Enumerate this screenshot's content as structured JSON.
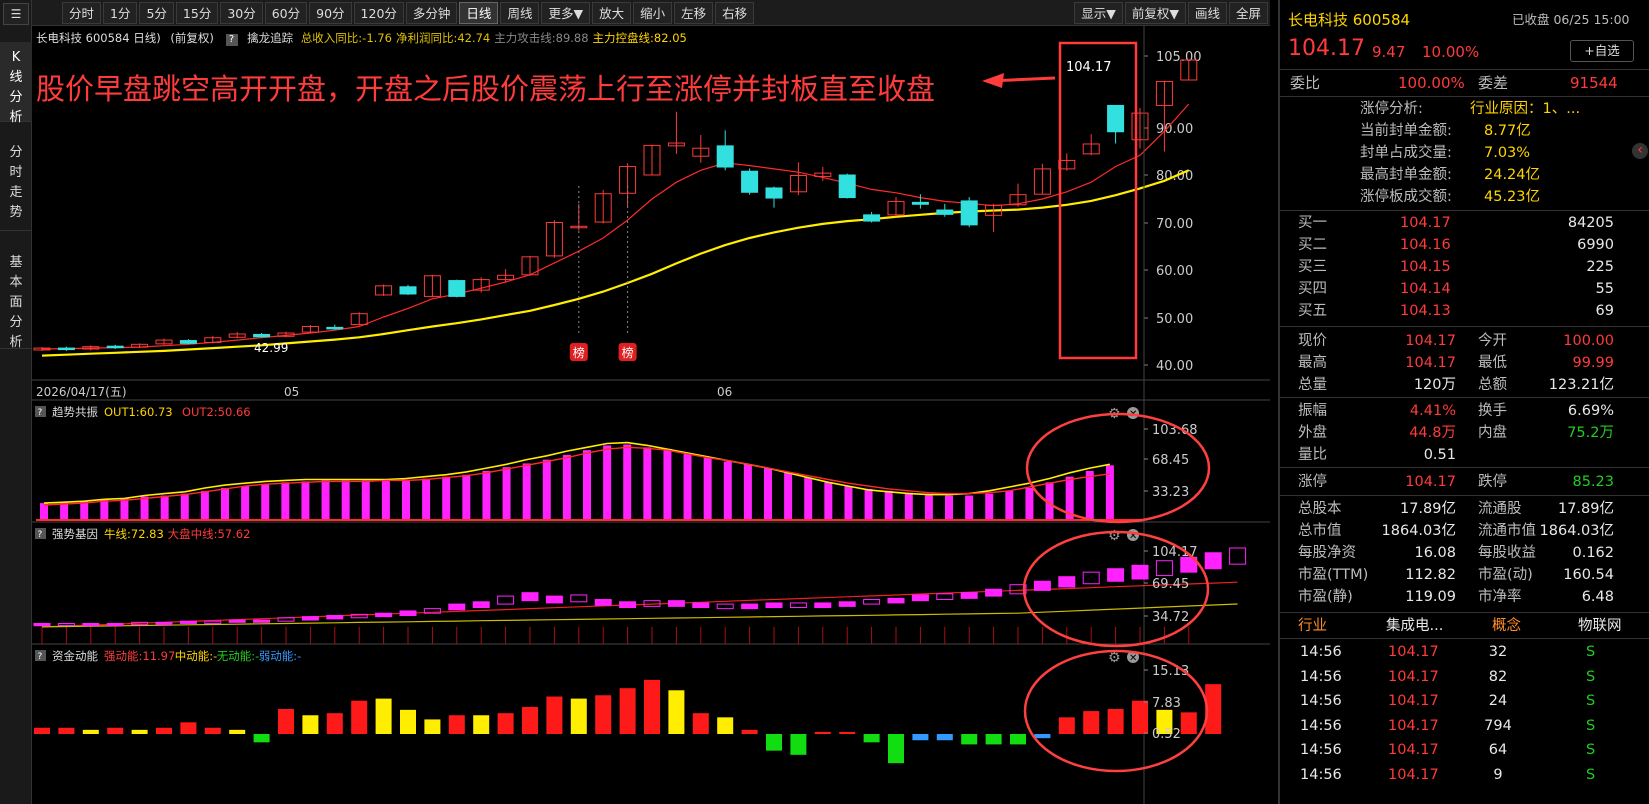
{
  "left_nav": {
    "items": [
      "K线分析",
      "分时走势",
      "基本面分析"
    ]
  },
  "toolbar": {
    "periods": [
      "分时",
      "1分",
      "5分",
      "15分",
      "30分",
      "60分",
      "90分",
      "120分",
      "多分钟",
      "日线",
      "周线",
      "更多▼",
      "放大",
      "缩小",
      "左移",
      "右移"
    ],
    "selected": "日线",
    "right": [
      "显示▼",
      "前复权▼",
      "画线",
      "全屏"
    ]
  },
  "info_bar": {
    "title": "长电科技 600584 日线)",
    "adj": "(前复权)",
    "help": "?",
    "indicator_name": "擒龙追踪",
    "items": [
      {
        "text": "总收入同比:-1.76",
        "color": "#e0c000"
      },
      {
        "text": "净利润同比:42.74",
        "color": "#e0c000"
      },
      {
        "text": "主力攻击线:89.88",
        "color": "#888888"
      },
      {
        "text": "主力控盘线:82.05",
        "color": "#ffd400"
      }
    ]
  },
  "annotation": "股价早盘跳空高开开盘，开盘之后股价震荡上行至涨停并封板直至收盘",
  "main_chart": {
    "price_axis": [
      "105.00",
      "90.00",
      "80.00",
      "70.00",
      "60.00",
      "50.00",
      "40.00"
    ],
    "last_price_label": "104.17",
    "low_label": "42.99",
    "markers": [
      "榜",
      "榜"
    ],
    "date_axis": [
      "2026/04/17(五)",
      "05",
      "06"
    ]
  },
  "panels": [
    {
      "help": "?",
      "name": "趋势共振",
      "fields": [
        {
          "text": "OUT1:60.73",
          "color": "#ffd400"
        },
        {
          "text": "OUT2:50.66",
          "color": "#ff3b3b"
        }
      ],
      "axis": [
        "103.68",
        "68.45",
        "33.23"
      ]
    },
    {
      "help": "?",
      "name": "强势基因",
      "fields": [
        {
          "text": "牛线:72.83",
          "color": "#ffd400"
        },
        {
          "text": "大盘中线:57.62",
          "color": "#ff3b3b"
        }
      ],
      "axis": [
        "104.17",
        "69.45",
        "34.72"
      ]
    },
    {
      "help": "?",
      "name": "资金动能",
      "fields": [
        {
          "text": "强动能:11.97",
          "color": "#ff3b3b"
        },
        {
          "text": "中动能:-",
          "color": "#ffd400"
        },
        {
          "text": "无动能:-",
          "color": "#22cc22"
        },
        {
          "text": "弱动能:-",
          "color": "#3399ff"
        }
      ],
      "axis": [
        "15.13",
        "7.83",
        "0.52"
      ]
    }
  ],
  "right_panel": {
    "name": "长电科技 600584",
    "status": "已收盘 06/25 15:00",
    "price": "104.17",
    "change": "9.47",
    "change_pct": "10.00%",
    "watch_btn": "+自选",
    "weibi_label": "委比",
    "weibi": "100.00%",
    "weicha_label": "委差",
    "weicha": "91544",
    "zt_analysis": [
      {
        "label": "涨停分析:",
        "value": "行业原因：1、..."
      },
      {
        "label": "当前封单金额:",
        "value": "8.77亿"
      },
      {
        "label": "封单占成交量:",
        "value": "7.03%"
      },
      {
        "label": "最高封单金额:",
        "value": "24.24亿"
      },
      {
        "label": "涨停板成交额:",
        "value": "45.23亿"
      }
    ],
    "bids": [
      {
        "label": "买一",
        "price": "104.17",
        "vol": "84205"
      },
      {
        "label": "买二",
        "price": "104.16",
        "vol": "6990"
      },
      {
        "label": "买三",
        "price": "104.15",
        "vol": "225"
      },
      {
        "label": "买四",
        "price": "104.14",
        "vol": "55"
      },
      {
        "label": "买五",
        "price": "104.13",
        "vol": "69"
      }
    ],
    "quote": [
      {
        "l1": "现价",
        "v1": "104.17",
        "c1": "red",
        "l2": "今开",
        "v2": "100.00",
        "c2": "red"
      },
      {
        "l1": "最高",
        "v1": "104.17",
        "c1": "red",
        "l2": "最低",
        "v2": "99.99",
        "c2": "red"
      },
      {
        "l1": "总量",
        "v1": "120万",
        "c1": "white",
        "l2": "总额",
        "v2": "123.21亿",
        "c2": "white"
      }
    ],
    "quote2": [
      {
        "l1": "振幅",
        "v1": "4.41%",
        "c1": "red",
        "l2": "换手",
        "v2": "6.69%",
        "c2": "white"
      },
      {
        "l1": "外盘",
        "v1": "44.8万",
        "c1": "red",
        "l2": "内盘",
        "v2": "75.2万",
        "c2": "green"
      },
      {
        "l1": "量比",
        "v1": "0.51",
        "c1": "white",
        "l2": "",
        "v2": "",
        "c2": "white"
      }
    ],
    "limits": {
      "l1": "涨停",
      "v1": "104.17",
      "l2": "跌停",
      "v2": "85.23"
    },
    "fundamentals": [
      {
        "l1": "总股本",
        "v1": "17.89亿",
        "l2": "流通股",
        "v2": "17.89亿"
      },
      {
        "l1": "总市值",
        "v1": "1864.03亿",
        "l2": "流通市值",
        "v2": "1864.03亿"
      },
      {
        "l1": "每股净资",
        "v1": "16.08",
        "l2": "每股收益",
        "v2": "0.162"
      },
      {
        "l1": "市盈(TTM)",
        "v1": "112.82",
        "l2": "市盈(动)",
        "v2": "160.54"
      },
      {
        "l1": "市盈(静)",
        "v1": "119.09",
        "l2": "市净率",
        "v2": "6.48"
      }
    ],
    "industry": {
      "l1": "行业",
      "v1": "集成电...",
      "l2": "概念",
      "v2": "物联网"
    },
    "ticks": [
      {
        "time": "14:56",
        "price": "104.17",
        "vol": "32",
        "side": "S"
      },
      {
        "time": "14:56",
        "price": "104.17",
        "vol": "82",
        "side": "S"
      },
      {
        "time": "14:56",
        "price": "104.17",
        "vol": "24",
        "side": "S"
      },
      {
        "time": "14:56",
        "price": "104.17",
        "vol": "794",
        "side": "S"
      },
      {
        "time": "14:56",
        "price": "104.17",
        "vol": "64",
        "side": "S"
      },
      {
        "time": "14:56",
        "price": "104.17",
        "vol": "9",
        "side": "S"
      }
    ]
  },
  "chart_data": {
    "type": "candlestick",
    "candles": [
      [
        43.2,
        43.6,
        42.99,
        43.8
      ],
      [
        43.6,
        43.3,
        43.0,
        43.9
      ],
      [
        43.4,
        43.9,
        43.1,
        44.2
      ],
      [
        44.0,
        43.7,
        43.4,
        44.3
      ],
      [
        43.8,
        44.4,
        43.6,
        44.6
      ],
      [
        44.5,
        45.3,
        44.3,
        45.6
      ],
      [
        45.2,
        44.6,
        44.4,
        45.5
      ],
      [
        44.8,
        45.8,
        44.6,
        46.2
      ],
      [
        45.9,
        46.6,
        45.7,
        47.0
      ],
      [
        46.5,
        46.0,
        45.8,
        46.8
      ],
      [
        46.1,
        46.8,
        45.9,
        47.1
      ],
      [
        47.0,
        48.2,
        46.8,
        48.5
      ],
      [
        48.0,
        47.8,
        47.5,
        48.6
      ],
      [
        48.6,
        50.9,
        48.4,
        51.2
      ],
      [
        54.8,
        56.7,
        54.6,
        57.0
      ],
      [
        56.5,
        55.0,
        54.8,
        56.9
      ],
      [
        54.5,
        58.8,
        54.3,
        59.0
      ],
      [
        57.8,
        54.5,
        54.3,
        58.0
      ],
      [
        55.8,
        58.0,
        55.3,
        58.5
      ],
      [
        58.0,
        58.9,
        57.4,
        60.2
      ],
      [
        59.0,
        62.8,
        58.8,
        63.0
      ],
      [
        63.0,
        70.1,
        62.6,
        70.6
      ],
      [
        69.0,
        69.3,
        68.4,
        74.0
      ],
      [
        70.2,
        76.1,
        69.9,
        76.9
      ],
      [
        76.2,
        81.8,
        73.4,
        82.5
      ],
      [
        80.0,
        86.3,
        80.0,
        86.3
      ],
      [
        86.2,
        86.8,
        84.5,
        93.4
      ],
      [
        84.0,
        85.7,
        82.6,
        88.5
      ],
      [
        86.2,
        81.7,
        81.0,
        89.5
      ],
      [
        80.8,
        76.4,
        75.9,
        81.4
      ],
      [
        77.3,
        75.2,
        73.2,
        77.6
      ],
      [
        76.5,
        79.9,
        75.8,
        82.7
      ],
      [
        79.7,
        80.4,
        78.8,
        81.7
      ],
      [
        80.0,
        75.3,
        75.1,
        80.3
      ],
      [
        71.7,
        70.4,
        70.1,
        72.3
      ],
      [
        71.7,
        74.5,
        71.4,
        75.4
      ],
      [
        74.3,
        73.9,
        73.0,
        76.0
      ],
      [
        72.7,
        71.8,
        71.3,
        74.0
      ],
      [
        74.6,
        69.6,
        69.1,
        75.4
      ],
      [
        71.6,
        73.7,
        68.1,
        74.0
      ],
      [
        73.8,
        75.9,
        73.4,
        78.2
      ],
      [
        76.0,
        81.3,
        76.0,
        82.4
      ],
      [
        81.3,
        83.1,
        80.9,
        84.6
      ],
      [
        84.5,
        86.6,
        84.2,
        88.7
      ],
      [
        94.7,
        89.2,
        86.7,
        89.2
      ],
      [
        87.5,
        93.1,
        85.6,
        94.2
      ],
      [
        94.7,
        99.7,
        85.0,
        99.7
      ],
      [
        100.0,
        104.17,
        99.99,
        104.17
      ]
    ],
    "ma_fast": [
      43.4,
      43.5,
      43.6,
      43.7,
      43.8,
      44.1,
      44.4,
      44.8,
      45.3,
      45.8,
      46.3,
      46.8,
      47.4,
      48.2,
      50.2,
      52.0,
      54.0,
      55.0,
      56.2,
      57.5,
      59.0,
      61.5,
      64.0,
      66.8,
      70.6,
      75.0,
      78.5,
      81.0,
      82.6,
      82.0,
      81.3,
      80.6,
      79.5,
      78.3,
      77.0,
      76.3,
      75.3,
      74.5,
      74.1,
      73.6,
      74.0,
      75.0,
      76.5,
      78.5,
      81.8,
      84.2,
      89.3,
      95.0
    ],
    "ma_slow": [
      42.0,
      42.2,
      42.4,
      42.6,
      42.8,
      43.0,
      43.3,
      43.6,
      43.9,
      44.2,
      44.6,
      45.0,
      45.4,
      45.9,
      46.6,
      47.4,
      48.2,
      48.9,
      49.7,
      50.6,
      51.5,
      52.7,
      54.0,
      55.5,
      57.3,
      59.2,
      61.4,
      63.5,
      65.3,
      66.8,
      68.0,
      69.0,
      69.8,
      70.4,
      70.8,
      71.3,
      71.7,
      72.1,
      72.4,
      72.6,
      72.8,
      73.2,
      73.8,
      74.6,
      75.8,
      77.2,
      78.8,
      81.0
    ],
    "panel1_bars": [
      20,
      21,
      22,
      24,
      25,
      27,
      28,
      30,
      33,
      36,
      38,
      40,
      42,
      43,
      44,
      44,
      44,
      44,
      45,
      46,
      48,
      50,
      54,
      58,
      62,
      66,
      71,
      76,
      81,
      82,
      79,
      76,
      72,
      68,
      64,
      61,
      57,
      52,
      47,
      42,
      38,
      35,
      33,
      31,
      29,
      28,
      28,
      30,
      33,
      36,
      42,
      48,
      54,
      60
    ],
    "panel1_out1": [
      20,
      21,
      22,
      24,
      25,
      28,
      30,
      32,
      36,
      39,
      41,
      43,
      44,
      45,
      45,
      45,
      45,
      45,
      46,
      48,
      50,
      53,
      57,
      61,
      66,
      70,
      75,
      79,
      83,
      84,
      81,
      77,
      73,
      69,
      65,
      61,
      57,
      52,
      47,
      42,
      38,
      34,
      32,
      30,
      29,
      29,
      30,
      33,
      37,
      41,
      46,
      52,
      57,
      61
    ],
    "panel1_out2": [
      18,
      19,
      20,
      22,
      23,
      25,
      27,
      29,
      32,
      35,
      38,
      40,
      41,
      42,
      43,
      43,
      43,
      44,
      44,
      45,
      47,
      49,
      52,
      56,
      60,
      64,
      68,
      73,
      77,
      79,
      78,
      76,
      72,
      68,
      65,
      61,
      57,
      53,
      49,
      45,
      41,
      38,
      35,
      33,
      31,
      30,
      30,
      31,
      33,
      37,
      41,
      45,
      48,
      51
    ],
    "panel2_bars": [
      [
        36,
        38
      ],
      [
        37,
        38
      ],
      [
        37,
        38
      ],
      [
        37,
        38
      ],
      [
        37,
        39
      ],
      [
        37,
        39
      ],
      [
        38,
        40
      ],
      [
        38,
        40
      ],
      [
        39,
        41
      ],
      [
        39,
        41
      ],
      [
        40,
        43
      ],
      [
        41,
        44
      ],
      [
        42,
        45
      ],
      [
        43,
        46
      ],
      [
        44,
        47
      ],
      [
        45,
        49
      ],
      [
        47,
        51
      ],
      [
        50,
        55
      ],
      [
        52,
        57
      ],
      [
        55,
        62
      ],
      [
        58,
        65
      ],
      [
        56,
        62
      ],
      [
        57,
        63
      ],
      [
        54,
        59
      ],
      [
        52,
        57
      ],
      [
        53,
        58
      ],
      [
        53,
        58
      ],
      [
        52,
        56
      ],
      [
        51,
        55
      ],
      [
        51,
        55
      ],
      [
        52,
        56
      ],
      [
        52,
        56
      ],
      [
        52,
        56
      ],
      [
        53,
        57
      ],
      [
        55,
        59
      ],
      [
        56,
        60
      ],
      [
        58,
        63
      ],
      [
        59,
        64
      ],
      [
        60,
        65
      ],
      [
        62,
        68
      ],
      [
        64,
        72
      ],
      [
        67,
        75
      ],
      [
        70,
        79
      ],
      [
        72.83,
        83
      ],
      [
        75,
        86
      ],
      [
        77,
        89
      ],
      [
        80,
        93
      ],
      [
        83,
        96
      ],
      [
        86,
        100
      ],
      [
        90,
        104.17
      ]
    ],
    "panel3_bars": [
      [
        1.5,
        "red"
      ],
      [
        1.5,
        "red"
      ],
      [
        1.0,
        "yellow"
      ],
      [
        1.5,
        "red"
      ],
      [
        1.0,
        "yellow"
      ],
      [
        1.5,
        "red"
      ],
      [
        2.8,
        "red"
      ],
      [
        1.5,
        "red"
      ],
      [
        1.0,
        "yellow"
      ],
      [
        -2.0,
        "green"
      ],
      [
        6.0,
        "red"
      ],
      [
        4.5,
        "yellow"
      ],
      [
        5.0,
        "red"
      ],
      [
        8.0,
        "red"
      ],
      [
        8.5,
        "yellow"
      ],
      [
        5.8,
        "yellow"
      ],
      [
        3.5,
        "yellow"
      ],
      [
        4.5,
        "red"
      ],
      [
        4.5,
        "yellow"
      ],
      [
        5.0,
        "red"
      ],
      [
        6.5,
        "red"
      ],
      [
        9.0,
        "red"
      ],
      [
        8.5,
        "yellow"
      ],
      [
        9.3,
        "red"
      ],
      [
        11.0,
        "red"
      ],
      [
        13.0,
        "red"
      ],
      [
        10.5,
        "yellow"
      ],
      [
        5.0,
        "red"
      ],
      [
        4.0,
        "yellow"
      ],
      [
        1.0,
        "red"
      ],
      [
        -4.0,
        "green"
      ],
      [
        -5.0,
        "green"
      ],
      [
        0.5,
        "red"
      ],
      [
        0.5,
        "red"
      ],
      [
        -2.0,
        "green"
      ],
      [
        -7.0,
        "green"
      ],
      [
        -1.5,
        "blue"
      ],
      [
        -1.5,
        "blue"
      ],
      [
        -2.5,
        "green"
      ],
      [
        -2.5,
        "green"
      ],
      [
        -2.5,
        "green"
      ],
      [
        -1.0,
        "blue"
      ],
      [
        4.0,
        "red"
      ],
      [
        5.5,
        "red"
      ],
      [
        6.0,
        "red"
      ],
      [
        8.0,
        "red"
      ],
      [
        5.8,
        "yellow"
      ],
      [
        5.2,
        "red"
      ],
      [
        11.97,
        "red"
      ]
    ]
  }
}
